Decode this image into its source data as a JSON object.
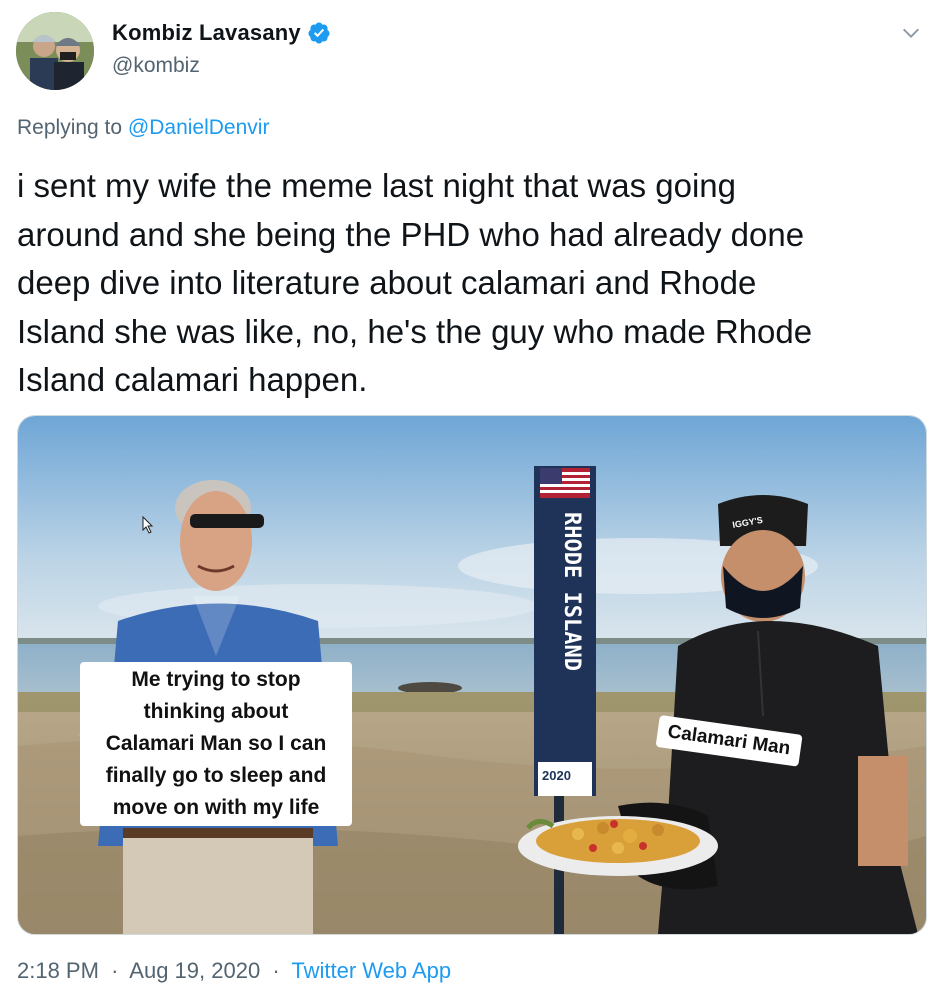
{
  "author": {
    "display_name": "Kombiz Lavasany",
    "handle": "@kombiz",
    "verified": true
  },
  "reply": {
    "prefix": "Replying to",
    "target": "@DanielDenvir"
  },
  "tweet": {
    "lines": [
      "i sent my wife the meme last night that was going",
      "around and she being the PHD who had already done",
      "deep dive into literature about calamari and Rhode",
      "Island she was like, no, he's the guy who made Rhode",
      "Island calamari happen."
    ]
  },
  "media": {
    "caption_left": [
      "Me trying to stop",
      "thinking about",
      "Calamari Man so I can",
      "finally go to sleep and",
      "move on with my life"
    ],
    "caption_right": "Calamari Man",
    "sign_text": "RHODE ISLAND",
    "sign_badge": "2020",
    "hat_logo": "IGGY'S"
  },
  "footer": {
    "time": "2:18 PM",
    "separator": "·",
    "date": "Aug 19, 2020",
    "source": "Twitter Web App"
  },
  "colors": {
    "link": "#1d9bf0",
    "secondary_text": "#536471",
    "verified": "#1d9bf0"
  },
  "icons": {
    "verified": "verified-badge-icon",
    "caret": "chevron-down-icon",
    "cursor": "mouse-pointer-icon"
  }
}
